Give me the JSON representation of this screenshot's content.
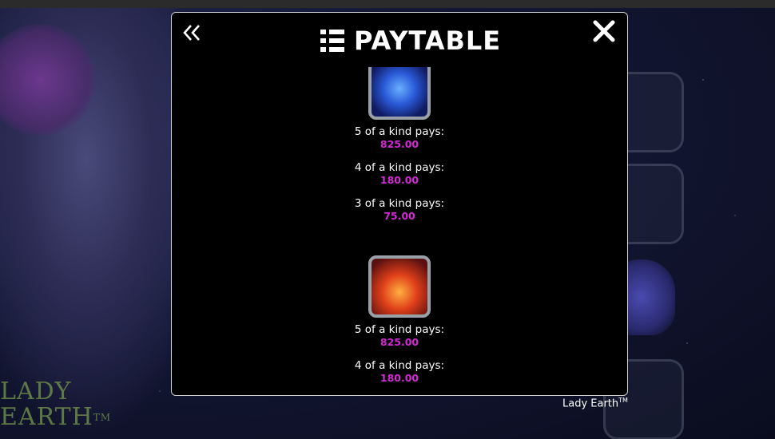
{
  "modal": {
    "title": "PAYTABLE",
    "back_icon": "double-chevron-left-icon",
    "close_icon": "close-x-icon",
    "title_icon": "list-icon"
  },
  "symbols": [
    {
      "icon": "water-swirl-symbol",
      "pays": [
        {
          "label": "5 of a kind pays:",
          "value": "825.00"
        },
        {
          "label": "4 of a kind pays:",
          "value": "180.00"
        },
        {
          "label": "3 of a kind pays:",
          "value": "75.00"
        }
      ]
    },
    {
      "icon": "fire-symbol",
      "pays": [
        {
          "label": "5 of a kind pays:",
          "value": "825.00"
        },
        {
          "label": "4 of a kind pays:",
          "value": "180.00"
        }
      ]
    }
  ],
  "background": {
    "logo_line1": "LADY",
    "logo_line2": "EARTH",
    "logo_tm": "TM"
  },
  "footer": {
    "brand": "Lady Earth",
    "tm": "TM"
  },
  "colors": {
    "pay_value": "#d42ad4",
    "modal_bg": "#000000",
    "modal_border": "#cfcfcf"
  }
}
